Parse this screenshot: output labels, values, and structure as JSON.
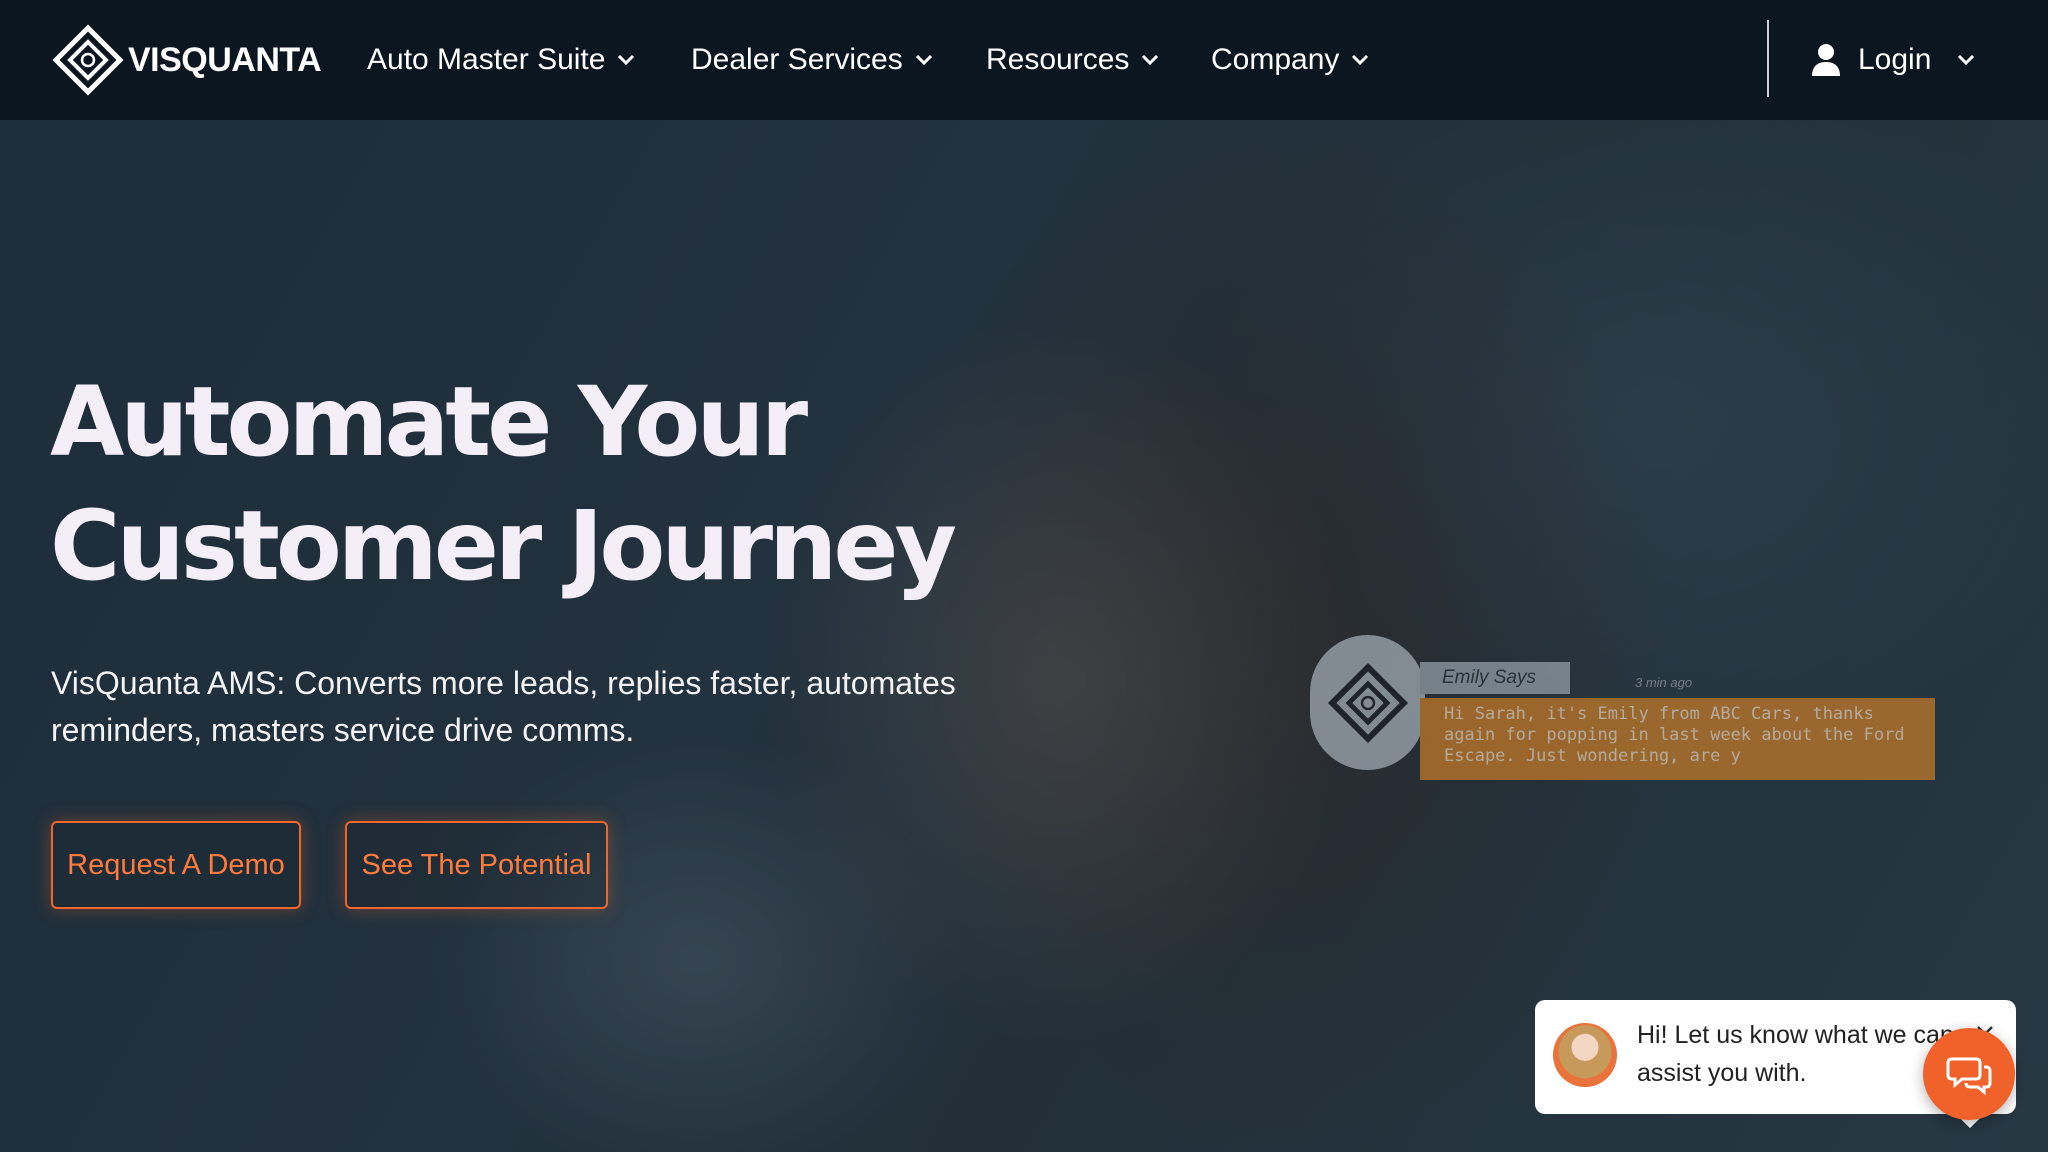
{
  "brand": {
    "logo_text": "VISQUANTA"
  },
  "nav": [
    {
      "label": "Auto Master Suite"
    },
    {
      "label": "Dealer Services"
    },
    {
      "label": "Resources"
    },
    {
      "label": "Company"
    }
  ],
  "login": {
    "label": "Login"
  },
  "hero": {
    "headline_line1": "Automate Your",
    "headline_line2": "Customer Journey",
    "subtitle": "VisQuanta AMS: Converts more leads, replies faster, automates reminders, masters service drive comms.",
    "cta_primary": "Request A Demo",
    "cta_secondary": "See The Potential"
  },
  "sms_preview": {
    "sender": "Emily Says",
    "time": "3 min ago",
    "message": "Hi Sarah, it's Emily from ABC Cars, thanks again for popping in last week about the Ford Escape. Just wondering, are y"
  },
  "chat_widget": {
    "message": "Hi! Let us know what we can assist you with."
  },
  "colors": {
    "header_bg": "#0c1620",
    "accent": "#f0662a",
    "headline": "#f4eef8"
  }
}
